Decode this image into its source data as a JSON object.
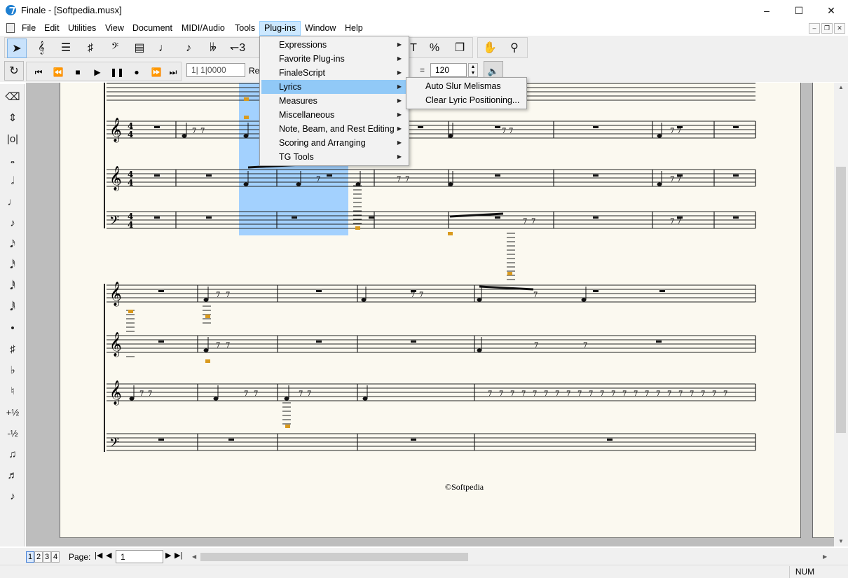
{
  "window": {
    "title": "Finale - [Softpedia.musx]",
    "minimize_icon": "minimize-icon",
    "maximize_icon": "maximize-icon",
    "close_icon": "close-icon"
  },
  "menubar": {
    "items": [
      "File",
      "Edit",
      "Utilities",
      "View",
      "Document",
      "MIDI/Audio",
      "Tools",
      "Plug-ins",
      "Window",
      "Help"
    ],
    "active": "Plug-ins"
  },
  "playback": {
    "counter": "1| 1|0000",
    "repeat_label": "Rep",
    "tempo_eq": "=",
    "tempo": "120"
  },
  "plugins_menu": {
    "items": [
      "Expressions",
      "Favorite Plug-ins",
      "FinaleScript",
      "Lyrics",
      "Measures",
      "Miscellaneous",
      "Note, Beam, and Rest Editing",
      "Scoring and Arranging",
      "TG Tools"
    ],
    "highlighted": "Lyrics"
  },
  "lyrics_submenu": {
    "items": [
      "Auto Slur Melismas",
      "Clear Lyric Positioning..."
    ]
  },
  "score": {
    "copyright": "©Softpedia",
    "time_sig_top": "4",
    "time_sig_bottom": "4"
  },
  "navigation": {
    "page_tabs": [
      "1",
      "2",
      "3",
      "4"
    ],
    "current_tab": "1",
    "page_label": "Page:",
    "page_value": "1"
  },
  "status": {
    "num": "NUM"
  },
  "colors": {
    "selection": "#99ccff",
    "menu_highlight": "#91c9f7",
    "menu_active_bg": "#cce8ff",
    "page_bg": "#fbf9f0",
    "note_accent": "#d99a1e"
  }
}
